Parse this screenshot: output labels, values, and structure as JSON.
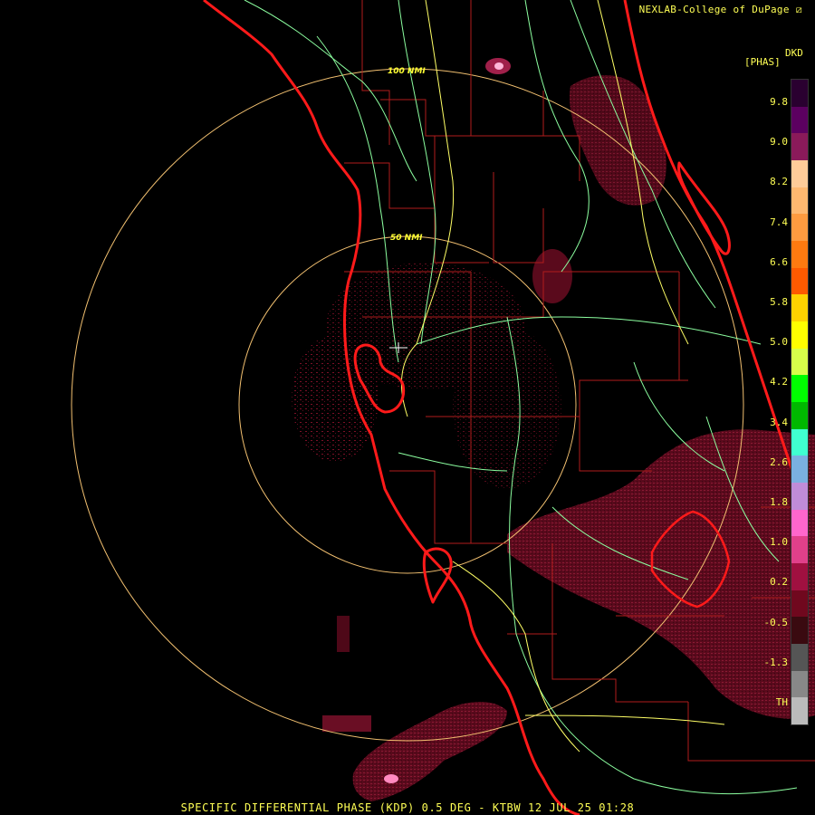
{
  "header": {
    "credit": "NEXLAB-College of DuPage ⧄"
  },
  "product": {
    "code": "DKD",
    "unit": "[PHAS]"
  },
  "rings": [
    {
      "label": "100 NMI"
    },
    {
      "label": "50 NMI"
    }
  ],
  "footer": {
    "caption": "SPECIFIC DIFFERENTIAL PHASE (KDP) 0.5 DEG - KTBW 12 JUL 25 01:28"
  },
  "legend": {
    "ticks": [
      "9.8",
      "9.0",
      "8.2",
      "7.4",
      "6.6",
      "5.8",
      "5.0",
      "4.2",
      "3.4",
      "2.6",
      "1.8",
      "1.0",
      "0.2",
      "-0.5",
      "-1.3",
      "TH"
    ],
    "colors": [
      "#2a0030",
      "#5c0060",
      "#8a1a5a",
      "#ffcc99",
      "#ffb870",
      "#ff9b40",
      "#ff7a10",
      "#ff5a00",
      "#ffd200",
      "#ffff00",
      "#d8ff4a",
      "#00ff00",
      "#00b800",
      "#40ffd0",
      "#7ab0e0",
      "#c08cd8",
      "#ff66cc",
      "#e0408a",
      "#a01040",
      "#70081e",
      "#3a0a10",
      "#555555",
      "#888888",
      "#bbbbbb"
    ]
  },
  "colors": {
    "coast": "#ff1a1a",
    "roads_green": "#8cffa0",
    "roads_yellow": "#ffff66",
    "county": "#b01c1c",
    "range_ring": "#f2c070",
    "echo": "#7a0f2a"
  }
}
